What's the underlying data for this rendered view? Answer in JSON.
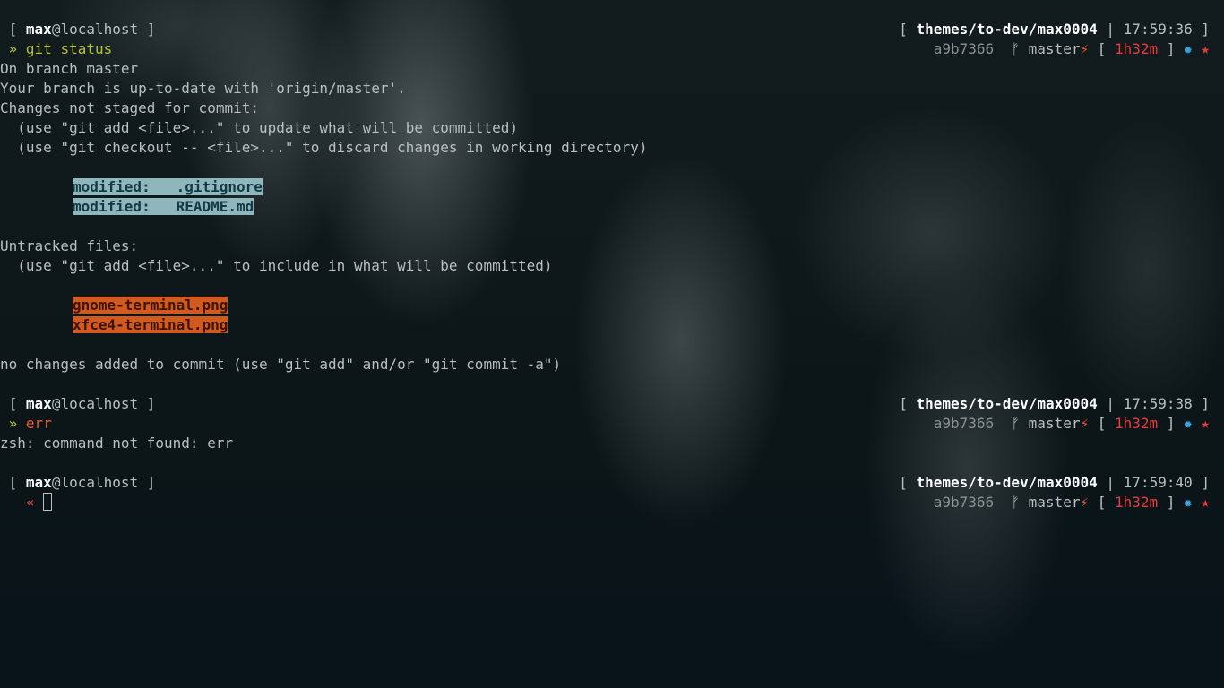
{
  "prompts": [
    {
      "user": "max",
      "host": "@localhost",
      "arrow": "»",
      "command": "git status",
      "path": "themes/to-dev/max0004",
      "time": "17:59:36",
      "hash": "a9b7366",
      "branch_icon": "ᚠ",
      "branch": "master",
      "dirty": "⚡",
      "duration": "1h32m",
      "gear": "✹",
      "star": "★"
    },
    {
      "user": "max",
      "host": "@localhost",
      "arrow": "»",
      "command": "err",
      "path": "themes/to-dev/max0004",
      "time": "17:59:38",
      "hash": "a9b7366",
      "branch_icon": "ᚠ",
      "branch": "master",
      "dirty": "⚡",
      "duration": "1h32m",
      "gear": "✹",
      "star": "★"
    },
    {
      "user": "max",
      "host": "@localhost",
      "arrow": "«",
      "command": "",
      "path": "themes/to-dev/max0004",
      "time": "17:59:40",
      "hash": "a9b7366",
      "branch_icon": "ᚠ",
      "branch": "master",
      "dirty": "⚡",
      "duration": "1h32m",
      "gear": "✹",
      "star": "★"
    }
  ],
  "git_output": {
    "branch_line": "On branch master",
    "uptodate_line": "Your branch is up-to-date with 'origin/master'.",
    "not_staged_header": "Changes not staged for commit:",
    "hint_add_update": "  (use \"git add <file>...\" to update what will be committed)",
    "hint_checkout": "  (use \"git checkout -- <file>...\" to discard changes in working directory)",
    "modified": [
      "modified:   .gitignore",
      "modified:   README.md"
    ],
    "untracked_header": "Untracked files:",
    "hint_add_include": "  (use \"git add <file>...\" to include in what will be committed)",
    "untracked": [
      "gnome-terminal.png",
      "xfce4-terminal.png"
    ],
    "summary_line": "no changes added to commit (use \"git add\" and/or \"git commit -a\")"
  },
  "err_output": "zsh: command not found: err",
  "colors": {
    "background": "#0a1416",
    "foreground": "#b9bfc1",
    "ok_green": "#b5c33a",
    "error_orange": "#e8582a",
    "red": "#e63c3c",
    "blue": "#3aa0d8",
    "modified_bg": "#8fb6bc",
    "untracked_bg": "#d25a1e"
  }
}
